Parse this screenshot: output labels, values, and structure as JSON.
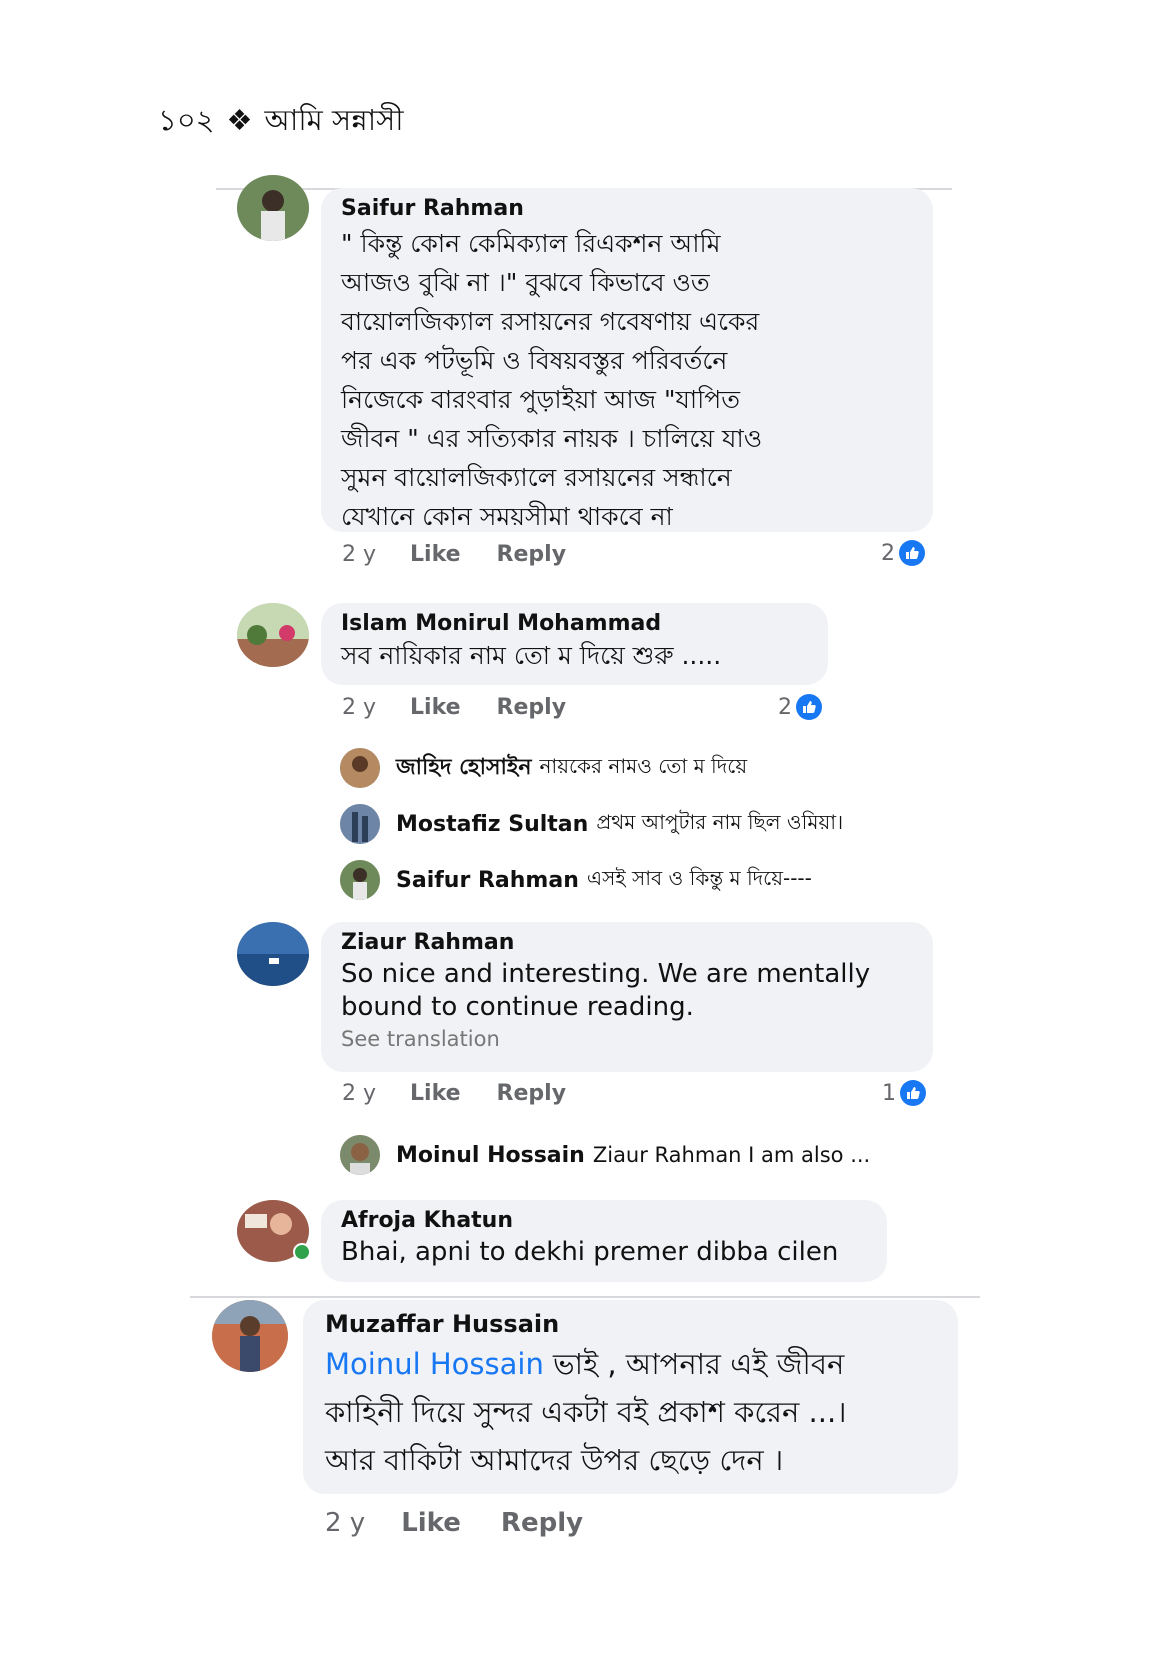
{
  "header": {
    "page_number": "১০২",
    "separator": "❖",
    "book_title": "আমি সন্নাসী"
  },
  "comments": [
    {
      "name": "Saifur Rahman",
      "lines": [
        "\" কিন্তু কোন  কেমিক্যাল রিএকশন আমি",
        "আজও বুঝি না ।\"  বুঝবে কিভাবে ওত",
        "বায়োলজিক্যাল রসায়নের গবেষণায় একের",
        "পর এক পটভূমি ও বিষয়বস্তুর পরিবর্তনে",
        "নিজেকে বারংবার  পুড়াইয়া আজ \"যাপিত",
        "জীবন \" এর সত্যিকার নায়ক । চালিয়ে যাও",
        "সুমন বায়োলজিক্যালে রসায়নের সন্ধানে",
        "যেখানে কোন সময়সীমা থাকবে না"
      ],
      "time": "2 y",
      "like": "Like",
      "reply": "Reply",
      "reactions": "2"
    },
    {
      "name": "Islam Monirul Mohammad",
      "lines": [
        "সব নায়িকার নাম তো ম দিয়ে শুরু ....."
      ],
      "time": "2 y",
      "like": "Like",
      "reply": "Reply",
      "reactions": "2",
      "replies": [
        {
          "name": "জাহিদ হোসাইন",
          "text": "নায়কের নামও তো ম দিয়ে"
        },
        {
          "name": "Mostafiz Sultan",
          "text": "প্রথম আপুটার নাম ছিল ওমিয়া।"
        },
        {
          "name": "Saifur Rahman",
          "text": "এসই সাব ও কিন্তু ম দিয়ে----"
        }
      ]
    },
    {
      "name": "Ziaur Rahman",
      "lines": [
        "So nice and interesting.  We are mentally",
        "bound to continue reading."
      ],
      "see_translation": "See translation",
      "time": "2 y",
      "like": "Like",
      "reply": "Reply",
      "reactions": "1",
      "replies": [
        {
          "name": "Moinul Hossain",
          "text": "Ziaur Rahman I am also ..."
        }
      ]
    },
    {
      "name": "Afroja Khatun",
      "lines": [
        "Bhai, apni to dekhi premer dibba cilen"
      ]
    },
    {
      "name": "Muzaffar Hussain",
      "mention": "Moinul Hossain",
      "lines": [
        " ভাই , আপনার এই জীবন",
        "কাহিনী দিয়ে সুন্দর একটা বই প্রকাশ করেন ...।",
        "আর বাকিটা আমাদের উপর ছেড়ে দেন ।"
      ],
      "time": "2 y",
      "like": "Like",
      "reply": "Reply"
    }
  ],
  "colors": {
    "bubble": "#f0f2f5",
    "like_blue": "#1877f2",
    "meta_gray": "#65676b",
    "online_green": "#31a24c"
  }
}
